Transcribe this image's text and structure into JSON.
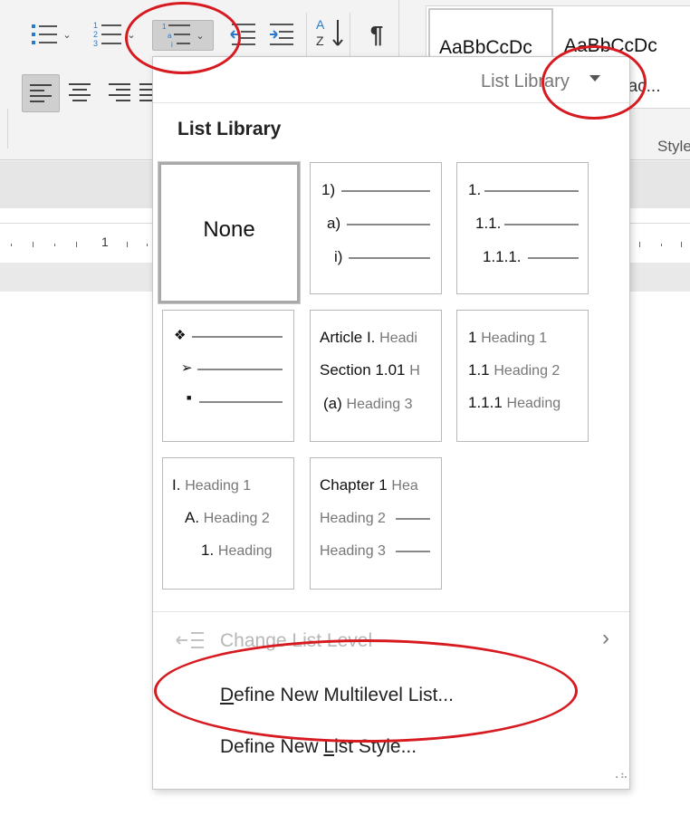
{
  "ribbon": {
    "styles_gallery": {
      "style1_sample": "AaBbCcDc",
      "style2_sample": "AaBbCcDc",
      "style2_sub": "pac..."
    },
    "styles_group_label": "Style"
  },
  "ruler": {
    "number_label": "1"
  },
  "menu": {
    "header_link": "List Library",
    "section_title": "List Library",
    "tiles": [
      {
        "kind": "none",
        "label": "None"
      },
      {
        "kind": "numbered",
        "lines": [
          "1)",
          "a)",
          "i)"
        ]
      },
      {
        "kind": "numbered",
        "lines": [
          "1.",
          "1.1.",
          "1.1.1."
        ]
      },
      {
        "kind": "bullets",
        "lines": [
          "❖",
          "➢",
          "■"
        ]
      },
      {
        "kind": "headings",
        "lines": [
          {
            "num": "Article I.",
            "text": "Headi"
          },
          {
            "num": "Section 1.01",
            "text": "H"
          },
          {
            "num": "(a)",
            "text": "Heading 3"
          }
        ]
      },
      {
        "kind": "headings",
        "lines": [
          {
            "num": "1",
            "text": "Heading 1"
          },
          {
            "num": "1.1",
            "text": "Heading 2"
          },
          {
            "num": "1.1.1",
            "text": "Heading"
          }
        ]
      },
      {
        "kind": "headings",
        "lines": [
          {
            "num": "I.",
            "text": "Heading 1"
          },
          {
            "num": "A.",
            "text": "Heading 2"
          },
          {
            "num": "1.",
            "text": "Heading"
          }
        ]
      },
      {
        "kind": "headings",
        "lines": [
          {
            "num": "Chapter 1",
            "text": "Hea"
          },
          {
            "num": "",
            "text": "Heading 2"
          },
          {
            "num": "",
            "text": "Heading 3"
          }
        ]
      }
    ],
    "change_list_level": "Change List Level",
    "define_multilevel_prefix": "D",
    "define_multilevel_rest": "efine New Multilevel List...",
    "define_list_style_a": "Define New ",
    "define_list_style_u": "L",
    "define_list_style_b": "ist Style..."
  },
  "colors": {
    "annotation": "#d71920",
    "accent_blue": "#2b79c9"
  }
}
